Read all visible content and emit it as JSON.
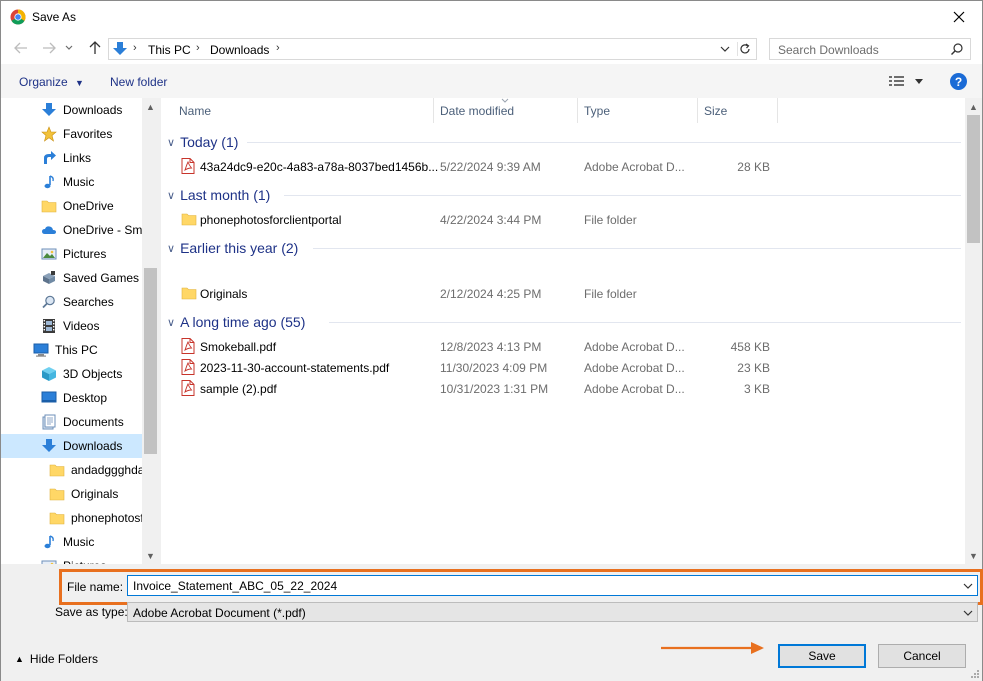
{
  "window": {
    "title": "Save As",
    "app_icon": "chrome-icon"
  },
  "address_bar": {
    "crumbs": [
      "This PC",
      "Downloads"
    ]
  },
  "search": {
    "placeholder": "Search Downloads"
  },
  "toolbar": {
    "organize_label": "Organize",
    "new_folder_label": "New folder"
  },
  "nav_pane": {
    "items": [
      {
        "label": "Downloads",
        "icon": "download-arrow-icon"
      },
      {
        "label": "Favorites",
        "icon": "star-icon"
      },
      {
        "label": "Links",
        "icon": "link-arrow-icon"
      },
      {
        "label": "Music",
        "icon": "music-note-icon"
      },
      {
        "label": "OneDrive",
        "icon": "folder-icon"
      },
      {
        "label": "OneDrive - Sm",
        "icon": "cloud-icon"
      },
      {
        "label": "Pictures",
        "icon": "pictures-icon"
      },
      {
        "label": "Saved Games",
        "icon": "saved-games-icon"
      },
      {
        "label": "Searches",
        "icon": "search-icon"
      },
      {
        "label": "Videos",
        "icon": "film-icon"
      },
      {
        "label": "This PC",
        "icon": "computer-icon"
      },
      {
        "label": "3D Objects",
        "icon": "cube-icon"
      },
      {
        "label": "Desktop",
        "icon": "desktop-icon"
      },
      {
        "label": "Documents",
        "icon": "documents-icon"
      },
      {
        "label": "Downloads",
        "icon": "download-arrow-icon"
      },
      {
        "label": "andadggghda",
        "icon": "folder-icon"
      },
      {
        "label": "Originals",
        "icon": "folder-icon"
      },
      {
        "label": "phonephotosf",
        "icon": "folder-icon"
      },
      {
        "label": "Music",
        "icon": "music-note-icon"
      },
      {
        "label": "Pictures",
        "icon": "pictures-icon"
      }
    ]
  },
  "columns": {
    "name": "Name",
    "date_modified": "Date modified",
    "type": "Type",
    "size": "Size"
  },
  "groups": [
    {
      "label": "Today (1)",
      "files": [
        {
          "name": "43a24dc9-e20c-4a83-a78a-8037bed1456b...",
          "date": "5/22/2024 9:39 AM",
          "type": "Adobe Acrobat D...",
          "size": "28 KB",
          "icon": "pdf-icon"
        }
      ]
    },
    {
      "label": "Last month (1)",
      "files": [
        {
          "name": "phonephotosforclientportal",
          "date": "4/22/2024 3:44 PM",
          "type": "File folder",
          "size": "",
          "icon": "folder-icon"
        }
      ]
    },
    {
      "label": "Earlier this year (2)",
      "files": [
        {
          "name": "Originals",
          "date": "2/12/2024 4:25 PM",
          "type": "File folder",
          "size": "",
          "icon": "folder-icon"
        }
      ]
    },
    {
      "label": "A long time ago (55)",
      "files": [
        {
          "name": "Smokeball.pdf",
          "date": "12/8/2023 4:13 PM",
          "type": "Adobe Acrobat D...",
          "size": "458 KB",
          "icon": "pdf-icon"
        },
        {
          "name": "2023-11-30-account-statements.pdf",
          "date": "11/30/2023 4:09 PM",
          "type": "Adobe Acrobat D...",
          "size": "23 KB",
          "icon": "pdf-icon"
        },
        {
          "name": "sample (2).pdf",
          "date": "10/31/2023 1:31 PM",
          "type": "Adobe Acrobat D...",
          "size": "3 KB",
          "icon": "pdf-icon"
        }
      ]
    }
  ],
  "file_name": {
    "label": "File name:",
    "value": "Invoice_Statement_ABC_05_22_2024"
  },
  "save_as_type": {
    "label": "Save as type:",
    "value": "Adobe Acrobat Document (*.pdf)"
  },
  "footer": {
    "hide_folders_label": "Hide Folders",
    "save_label": "Save",
    "cancel_label": "Cancel"
  },
  "colors": {
    "highlight": "#e8701f",
    "accent": "#0078d7",
    "group_text": "#1e3287",
    "selected_bg": "#cce8ff"
  }
}
